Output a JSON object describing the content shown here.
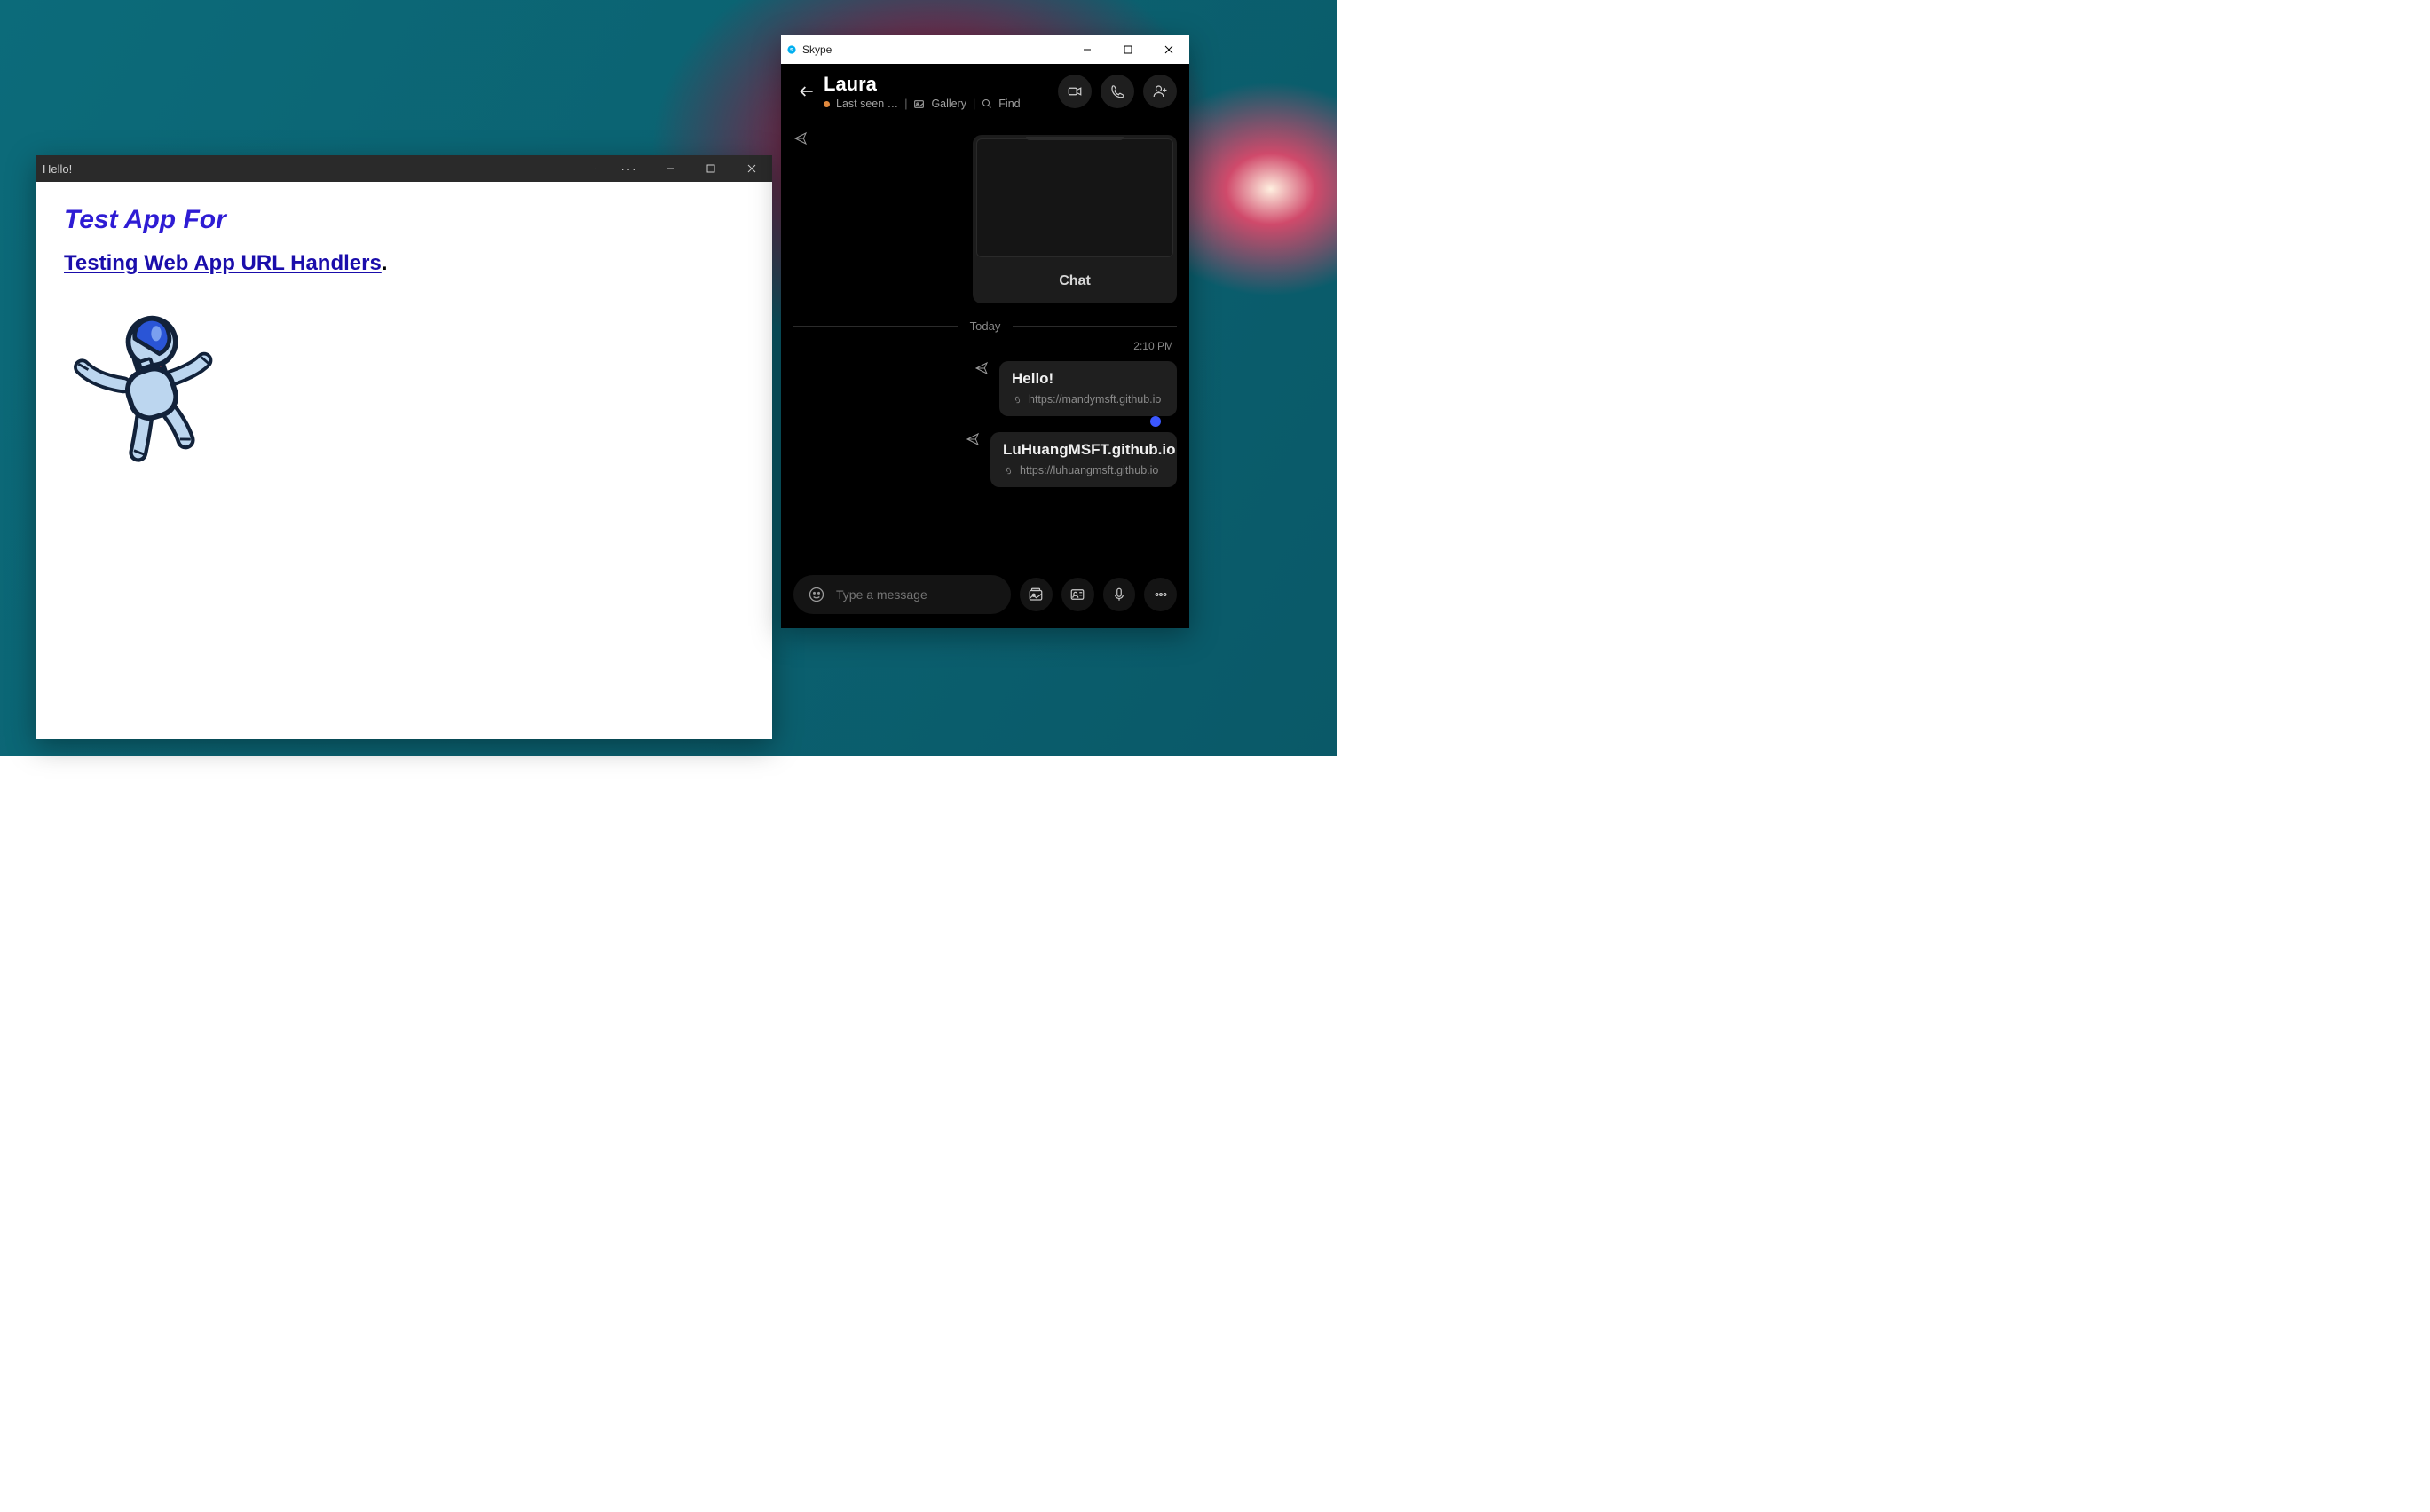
{
  "app": {
    "title": "Hello!",
    "heading": "Test App For",
    "link_text": "Testing Web App URL Handlers",
    "period": "."
  },
  "skype": {
    "title": "Skype",
    "contact": {
      "name": "Laura",
      "status": "Last seen …",
      "gallery_label": "Gallery",
      "find_label": "Find"
    },
    "preview_card": {
      "chat_label": "Chat"
    },
    "date_divider": "Today",
    "messages": [
      {
        "time": "2:10 PM",
        "title": "Hello!",
        "url": "https://mandymsft.github.io"
      },
      {
        "title": "LuHuangMSFT.github.io",
        "url": "https://luhuangmsft.github.io"
      }
    ],
    "input": {
      "placeholder": "Type a message"
    }
  }
}
